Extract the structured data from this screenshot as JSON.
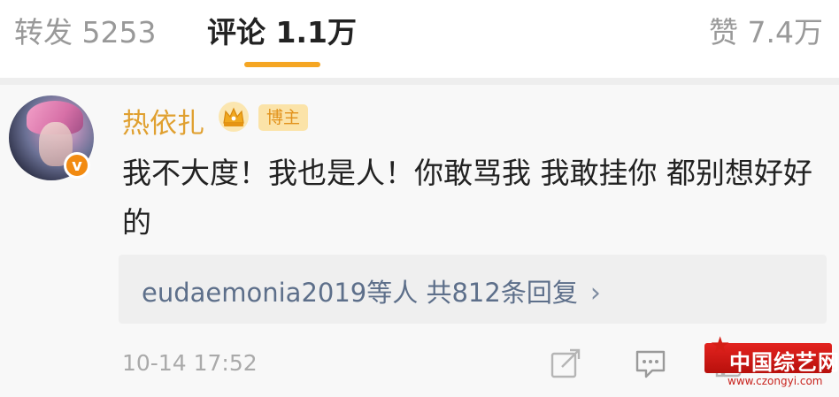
{
  "tabs": {
    "repost": "转发 5253",
    "comment": "评论 1.1万",
    "like": "赞 7.4万",
    "active": "comment",
    "accent_color": "#f5a623"
  },
  "comment": {
    "username": "热依扎",
    "username_color": "#e0a030",
    "avatar_badge": "v",
    "crown_icon": "crown-icon",
    "role_badge": "博主",
    "text": "我不大度！我也是人！你敢骂我 我敢挂你 都别想好好的",
    "reply_summary": "eudaemonia2019等人 共812条回复",
    "reply_chevron": "›",
    "timestamp": "10-14 17:52",
    "actions": [
      "share-icon",
      "reply-icon",
      "like-icon"
    ]
  },
  "watermark": {
    "title": "中国综艺网",
    "url": "www.czongyi.com"
  }
}
